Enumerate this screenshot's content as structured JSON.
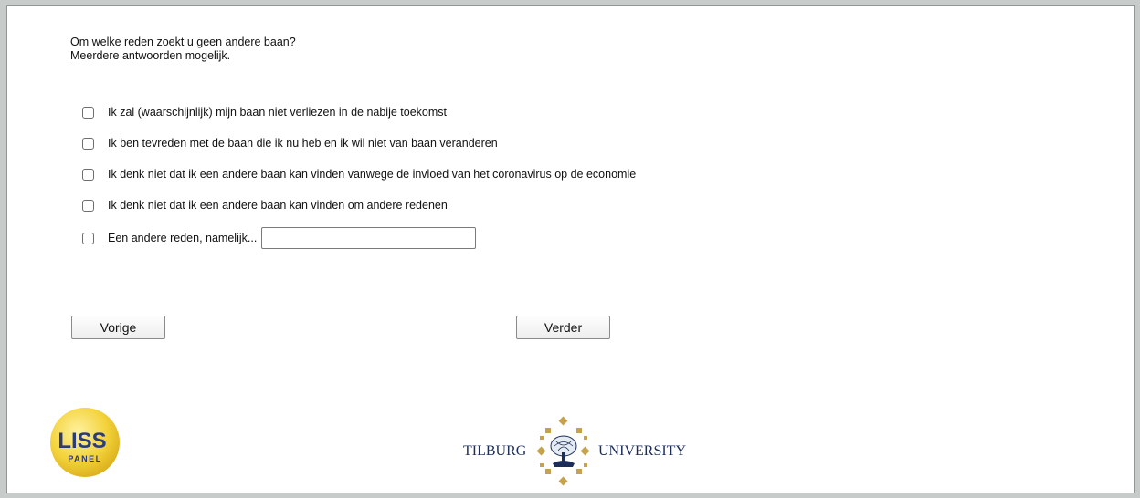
{
  "question": {
    "line1": "Om welke reden zoekt u geen andere baan?",
    "line2": "Meerdere antwoorden mogelijk."
  },
  "options": [
    {
      "label": "Ik zal (waarschijnlijk) mijn baan niet verliezen in de nabije toekomst",
      "checked": false
    },
    {
      "label": "Ik ben tevreden met de baan die ik nu heb en ik wil niet van baan veranderen",
      "checked": false
    },
    {
      "label": "Ik denk niet dat ik een andere baan kan vinden vanwege de invloed van het coronavirus op de economie",
      "checked": false
    },
    {
      "label": "Ik denk niet dat ik een andere baan kan vinden om andere redenen",
      "checked": false
    },
    {
      "label": "Een andere reden, namelijk...",
      "checked": false,
      "input_value": ""
    }
  ],
  "buttons": {
    "previous": "Vorige",
    "next": "Verder"
  },
  "footer": {
    "liss_logo_top": "LISS",
    "liss_logo_bottom": "PANEL",
    "university_left": "TILBURG",
    "university_right": "UNIVERSITY"
  },
  "colors": {
    "frame": "#c7cbca",
    "liss_yellow": "#f3d23a",
    "liss_blue": "#2a3d7a",
    "tilburg_gold": "#c8a24a",
    "tilburg_navy": "#1d2d5a"
  }
}
